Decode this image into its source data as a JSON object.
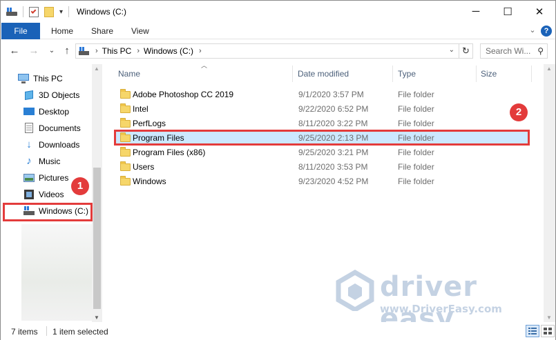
{
  "window": {
    "title": "Windows (C:)",
    "controls": {
      "minimize": "─",
      "maximize": "☐",
      "close": "✕"
    }
  },
  "ribbon": {
    "tabs": [
      "File",
      "Home",
      "Share",
      "View"
    ],
    "collapse_glyph": "⌄",
    "help_glyph": "?",
    "accent_color": "#1a62b8"
  },
  "nav": {
    "back_glyph": "←",
    "forward_glyph": "→",
    "recent_glyph": "⌄",
    "up_glyph": "↑",
    "breadcrumb": [
      "This PC",
      "Windows (C:)"
    ],
    "separator_glyph": "›",
    "dropdown_glyph": "⌄",
    "refresh_glyph": "↻",
    "search_placeholder": "Search Wi...",
    "search_glyph": "⚲"
  },
  "sidebar": {
    "items": [
      {
        "label": "This PC",
        "icon": "computer-icon"
      },
      {
        "label": "3D Objects",
        "icon": "cube-icon"
      },
      {
        "label": "Desktop",
        "icon": "desktop-icon"
      },
      {
        "label": "Documents",
        "icon": "document-icon"
      },
      {
        "label": "Downloads",
        "icon": "download-icon"
      },
      {
        "label": "Music",
        "icon": "music-icon"
      },
      {
        "label": "Pictures",
        "icon": "picture-icon"
      },
      {
        "label": "Videos",
        "icon": "video-icon"
      },
      {
        "label": "Windows (C:)",
        "icon": "drive-icon"
      }
    ]
  },
  "columns": {
    "name": "Name",
    "date": "Date modified",
    "type": "Type",
    "size": "Size"
  },
  "files": [
    {
      "name": "Adobe Photoshop CC 2019",
      "date": "9/1/2020 3:57 PM",
      "type": "File folder",
      "selected": false
    },
    {
      "name": "Intel",
      "date": "9/22/2020 6:52 PM",
      "type": "File folder",
      "selected": false
    },
    {
      "name": "PerfLogs",
      "date": "8/11/2020 3:22 PM",
      "type": "File folder",
      "selected": false
    },
    {
      "name": "Program Files",
      "date": "9/25/2020 2:13 PM",
      "type": "File folder",
      "selected": true
    },
    {
      "name": "Program Files (x86)",
      "date": "9/25/2020 3:21 PM",
      "type": "File folder",
      "selected": false
    },
    {
      "name": "Users",
      "date": "8/11/2020 3:53 PM",
      "type": "File folder",
      "selected": false
    },
    {
      "name": "Windows",
      "date": "9/23/2020 4:52 PM",
      "type": "File folder",
      "selected": false
    }
  ],
  "annotations": {
    "step1": "1",
    "step2": "2",
    "color": "#e33b3b"
  },
  "watermark": {
    "brand": "driver easy",
    "url": "www.DriverEasy.com"
  },
  "status": {
    "item_count": "7 items",
    "selection": "1 item selected"
  }
}
